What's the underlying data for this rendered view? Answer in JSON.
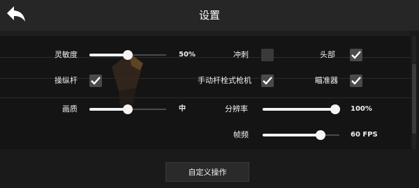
{
  "header": {
    "title": "设置"
  },
  "settings": {
    "sensitivity": {
      "label": "灵敏度",
      "value_text": "50%",
      "fraction": 0.5
    },
    "dash": {
      "label": "冲刺",
      "checked": false
    },
    "head": {
      "label": "头部",
      "checked": true
    },
    "joystick": {
      "label": "操纵杆",
      "checked": true
    },
    "manual_bolt_rifle": {
      "label": "手动杆栓式枪机",
      "checked": true
    },
    "crosshair": {
      "label": "瞄准器",
      "checked": true
    },
    "quality": {
      "label": "画质",
      "value_text": "中",
      "fraction": 0.5
    },
    "resolution": {
      "label": "分辨率",
      "value_text": "100%",
      "fraction": 1.0
    },
    "fps": {
      "label": "帧频",
      "value_text": "60 FPS",
      "fraction": 0.75
    }
  },
  "footer": {
    "custom_button_label": "自定义操作"
  },
  "icons": {
    "back": "back-arrow-icon",
    "check": "checkmark-icon"
  },
  "colors": {
    "background": "#1a1a1a",
    "header": "#262626",
    "accent": "#ffffff"
  }
}
